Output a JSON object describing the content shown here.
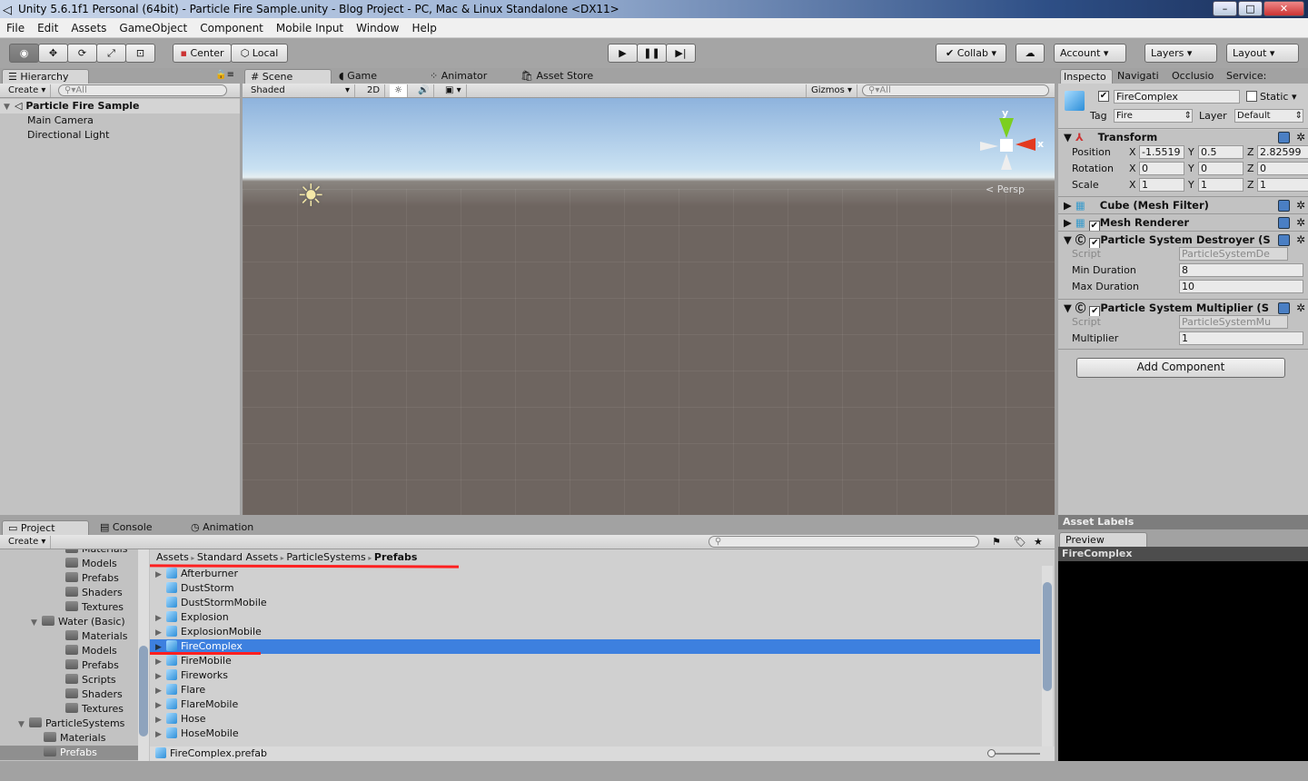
{
  "window": {
    "title": "Unity 5.6.1f1 Personal (64bit) - Particle Fire Sample.unity - Blog Project - PC, Mac & Linux Standalone <DX11>"
  },
  "menu": [
    "File",
    "Edit",
    "Assets",
    "GameObject",
    "Component",
    "Mobile Input",
    "Window",
    "Help"
  ],
  "toolbar": {
    "center": "Center",
    "local": "Local",
    "collab": "Collab",
    "account": "Account",
    "layers": "Layers",
    "layout": "Layout"
  },
  "hierarchy": {
    "tab": "Hierarchy",
    "create": "Create",
    "search_placeholder": "All",
    "scene": "Particle Fire Sample",
    "items": [
      "Main Camera",
      "Directional Light"
    ]
  },
  "scene": {
    "tabs": [
      "Scene",
      "Game",
      "Animator",
      "Asset Store"
    ],
    "shading": "Shaded",
    "mode2d": "2D",
    "gizmos": "Gizmos",
    "search_placeholder": "All",
    "persp": "Persp",
    "axis_y": "y",
    "axis_x": "x"
  },
  "inspector": {
    "tabs": [
      "Inspecto",
      "Navigati",
      "Occlusio",
      "Service:"
    ],
    "name": "FireComplex",
    "static": "Static",
    "tag_label": "Tag",
    "tag": "Fire",
    "layer_label": "Layer",
    "layer": "Default",
    "transform": {
      "title": "Transform",
      "rows": [
        {
          "label": "Position",
          "x": "-1.5519",
          "y": "0.5",
          "z": "2.82599"
        },
        {
          "label": "Rotation",
          "x": "0",
          "y": "0",
          "z": "0"
        },
        {
          "label": "Scale",
          "x": "1",
          "y": "1",
          "z": "1"
        }
      ]
    },
    "mesh_filter": "Cube (Mesh Filter)",
    "mesh_renderer": "Mesh Renderer",
    "destroyer": {
      "title": "Particle System Destroyer (S",
      "script_label": "Script",
      "script": "ParticleSystemDe",
      "min_label": "Min Duration",
      "min": "8",
      "max_label": "Max Duration",
      "max": "10"
    },
    "multiplier": {
      "title": "Particle System Multiplier (S",
      "script_label": "Script",
      "script": "ParticleSystemMu",
      "mult_label": "Multiplier",
      "mult": "1"
    },
    "add_component": "Add Component",
    "asset_labels": "Asset Labels",
    "preview": "Preview",
    "preview_name": "FireComplex"
  },
  "project": {
    "tabs": [
      "Project",
      "Console",
      "Animation"
    ],
    "create": "Create",
    "tree": [
      {
        "label": "Materials",
        "indent": 2
      },
      {
        "label": "Models",
        "indent": 2
      },
      {
        "label": "Prefabs",
        "indent": 2
      },
      {
        "label": "Shaders",
        "indent": 2
      },
      {
        "label": "Textures",
        "indent": 2
      },
      {
        "label": "Water (Basic)",
        "indent": 1,
        "open": true
      },
      {
        "label": "Materials",
        "indent": 2
      },
      {
        "label": "Models",
        "indent": 2
      },
      {
        "label": "Prefabs",
        "indent": 2
      },
      {
        "label": "Scripts",
        "indent": 2
      },
      {
        "label": "Shaders",
        "indent": 2
      },
      {
        "label": "Textures",
        "indent": 2
      },
      {
        "label": "ParticleSystems",
        "indent": 0,
        "open": true
      },
      {
        "label": "Materials",
        "indent": 1
      },
      {
        "label": "Prefabs",
        "indent": 1,
        "selected": true
      }
    ],
    "breadcrumb": [
      "Assets",
      "Standard Assets",
      "ParticleSystems",
      "Prefabs"
    ],
    "items": [
      {
        "label": "Afterburner",
        "expand": true
      },
      {
        "label": "DustStorm",
        "expand": false
      },
      {
        "label": "DustStormMobile",
        "expand": false
      },
      {
        "label": "Explosion",
        "expand": true
      },
      {
        "label": "ExplosionMobile",
        "expand": true
      },
      {
        "label": "FireComplex",
        "expand": true,
        "selected": true
      },
      {
        "label": "FireMobile",
        "expand": true
      },
      {
        "label": "Fireworks",
        "expand": true
      },
      {
        "label": "Flare",
        "expand": true
      },
      {
        "label": "FlareMobile",
        "expand": true
      },
      {
        "label": "Hose",
        "expand": true
      },
      {
        "label": "HoseMobile",
        "expand": true
      }
    ],
    "selected_file": "FireComplex.prefab"
  },
  "colors": {
    "selection": "#3d80df",
    "annotation": "#ff2020",
    "sky": "#8fb5de",
    "ground": "#6e6560"
  }
}
